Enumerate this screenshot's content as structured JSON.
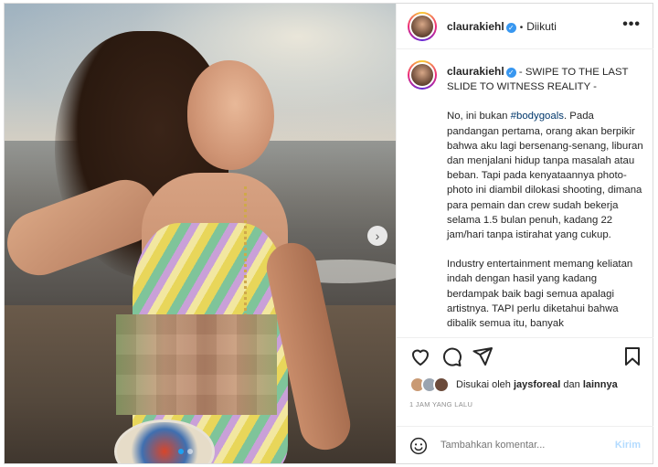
{
  "post": {
    "username": "claurakiehl",
    "follow_status": "Diikuti",
    "more_label": "•••",
    "carousel": {
      "next_label": "›",
      "slide_count": 2,
      "active_slide": 1
    }
  },
  "caption": {
    "username": "claurakiehl",
    "headline": " - SWIPE TO THE LAST SLIDE TO WITNESS REALITY -",
    "p1_before": "No, ini bukan ",
    "hashtag": "#bodygoals",
    "p1_after": ". Pada pandangan pertama, orang akan berpikir bahwa aku lagi bersenang-senang, liburan dan menjalani hidup tanpa masalah atau beban. Tapi pada kenyataannya photo-photo ini diambil dilokasi shooting, dimana para pemain dan crew sudah bekerja selama 1.5 bulan penuh, kadang 22 jam/hari tanpa istirahat yang cukup.",
    "p2": "Industry entertainment memang keliatan indah dengan hasil yang kadang berdampak baik bagi semua apalagi artistnya. TAPI perlu diketahui bahwa dibalik semua itu, banyak"
  },
  "likes": {
    "prefix": "Disukai oleh ",
    "user": "jaysforeal",
    "middle": " dan ",
    "others": "lainnya"
  },
  "timestamp": "1 JAM YANG LALU",
  "comment": {
    "placeholder": "Tambahkan komentar...",
    "send_label": "Kirim"
  },
  "icons": {
    "like": "heart-icon",
    "comment": "comment-icon",
    "share": "send-icon",
    "save": "bookmark-icon",
    "emoji": "emoji-icon"
  },
  "colors": {
    "verified": "#3897f0",
    "hashtag": "#00376b",
    "send_disabled": "#b3dbff",
    "carousel_active_dot": "#1da1f2"
  }
}
